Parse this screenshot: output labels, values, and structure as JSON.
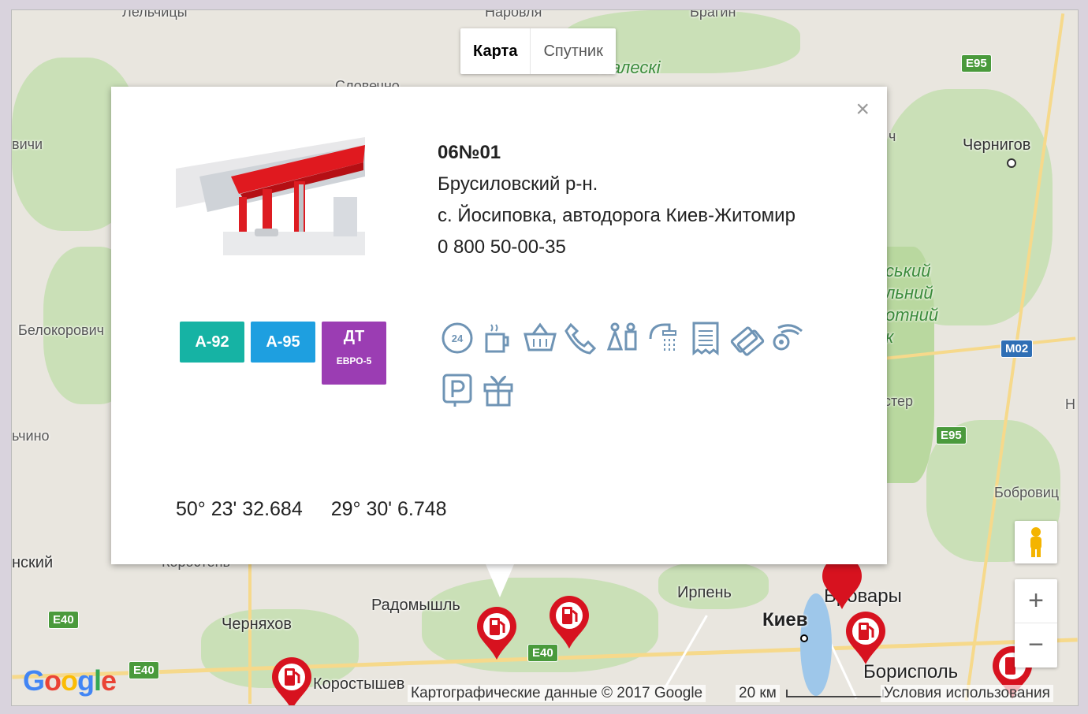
{
  "map_type": {
    "map_label": "Карта",
    "satellite_label": "Спутник"
  },
  "towns": {
    "lelchitsy": "Лельчицы",
    "narovlya": "Наровля",
    "bragin": "Брагин",
    "slovechno": "Словечно",
    "vichi": "вичи",
    "chernigov": "Чернигов",
    "belokorovichi": "Белокорович",
    "chino": "ьчино",
    "nskiy": "нский",
    "chernyakhov": "Черняхов",
    "radomyshl": "Радомышль",
    "korostyshev": "Коростышев",
    "irpen": "Ирпень",
    "kiev": "Киев",
    "brovary": "Бровары",
    "boryspil": "Борисполь",
    "bobrovitsa": "Бобровиц",
    "oster": "стер",
    "n_edge": "Н",
    "ch_edge": "ч",
    "korosten_cut": "Коростень"
  },
  "park_labels": {
    "paleskie": "Палескі",
    "park_line1": "ський",
    "park_line2": "льний",
    "park_line3": "отний",
    "park_line4": "к"
  },
  "road_shields": {
    "e95_top": "E95",
    "e95_mid": "E95",
    "m02": "M02",
    "e40_left": "E40",
    "e40_bottom": "E40",
    "e40_center": "E40"
  },
  "popup": {
    "close_label": "×",
    "station_code": "06№01",
    "district": "Брусиловский р-н.",
    "address": "с. Йосиповка, автодорога Киев-Житомир",
    "phone": "0 800 50-00-35",
    "fuels": [
      {
        "label": "А-92",
        "color": "#16b3a4"
      },
      {
        "label": "А-95",
        "color": "#1e9fe0"
      },
      {
        "label": "ДТ",
        "sub": "ЕВРО-5",
        "color": "#9b3db3"
      }
    ],
    "services": [
      "24h-clock-icon",
      "coffee-icon",
      "shop-basket-icon",
      "phone-icon",
      "wc-icon",
      "shower-icon",
      "receipt-icon",
      "payment-card-icon",
      "car-wash-icon",
      "parking-icon",
      "gift-icon"
    ],
    "latitude": "50° 23' 32.684",
    "longitude": "29° 30' 6.748"
  },
  "attribution": {
    "map_data": "Картографические данные © 2017 Google",
    "scale": "20 км",
    "terms": "Условия использования"
  },
  "logo": "Google",
  "controls": {
    "zoom_in": "+",
    "zoom_out": "−"
  },
  "colors": {
    "pin_red": "#d7121f",
    "service_icon": "#6f94b5"
  }
}
